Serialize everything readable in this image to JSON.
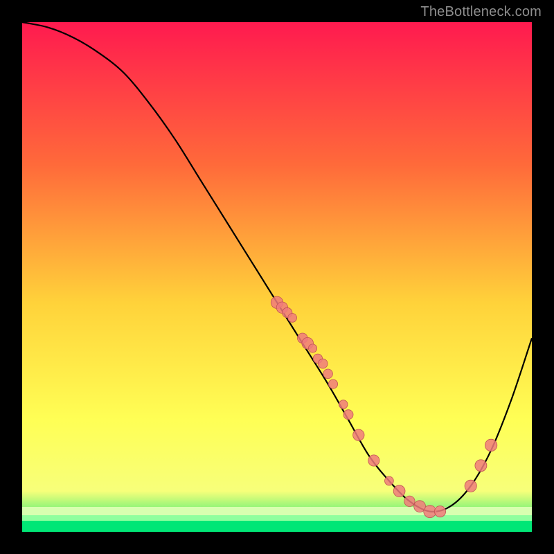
{
  "attribution": "TheBottleneck.com",
  "colors": {
    "top": "#ff1a4f",
    "quarter": "#ff6a3a",
    "mid": "#ffd23a",
    "low": "#ffff55",
    "bottom_band_top": "#f7ff7a",
    "bottom_band_bottom": "#00e676",
    "curve": "#000000",
    "dot_fill": "#f07b7b",
    "dot_stroke": "#c05454"
  },
  "chart_data": {
    "type": "line",
    "title": "",
    "xlabel": "",
    "ylabel": "",
    "xlim": [
      0,
      100
    ],
    "ylim": [
      0,
      100
    ],
    "curve": {
      "x": [
        0,
        5,
        10,
        15,
        20,
        25,
        30,
        35,
        40,
        45,
        50,
        55,
        60,
        64,
        68,
        72,
        76,
        80,
        84,
        88,
        92,
        96,
        100
      ],
      "y": [
        100,
        99,
        97,
        94,
        90,
        84,
        77,
        69,
        61,
        53,
        45,
        37,
        29,
        22,
        15,
        10,
        6,
        4,
        5,
        9,
        16,
        26,
        38
      ]
    },
    "series": [
      {
        "name": "points",
        "type": "scatter",
        "x": [
          50,
          51,
          52,
          53,
          55,
          56,
          57,
          58,
          59,
          60,
          61,
          63,
          64,
          66,
          69,
          72,
          74,
          76,
          78,
          80,
          82,
          88,
          90,
          92
        ],
        "y": [
          45,
          44,
          43,
          42,
          38,
          37,
          36,
          34,
          33,
          31,
          29,
          25,
          23,
          19,
          14,
          10,
          8,
          6,
          5,
          4,
          4,
          9,
          13,
          17
        ]
      }
    ]
  }
}
